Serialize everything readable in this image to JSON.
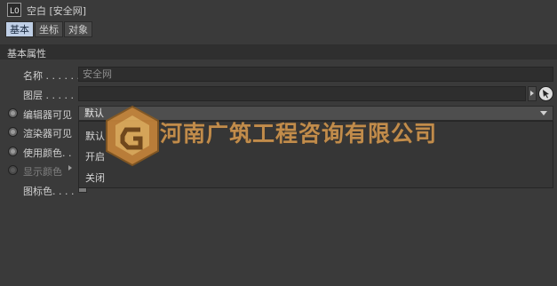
{
  "window": {
    "title": "空白 [安全网]",
    "object_icon_glyph": "L0"
  },
  "tabs": [
    "基本",
    "坐标",
    "对象"
  ],
  "section": {
    "title": "基本属性"
  },
  "fields": {
    "name": {
      "label": "名称 . . . . . .",
      "value": "安全网"
    },
    "layer": {
      "label": "图层 . . . . .",
      "value": ""
    },
    "editor_visible": {
      "label": "编辑器可见",
      "value": "默认"
    },
    "render_visible": {
      "label": "渲染器可见"
    },
    "use_color": {
      "label": "使用颜色. ."
    },
    "display_color": {
      "label": "显示颜色"
    },
    "icon_color": {
      "label": "图标色. . . ."
    }
  },
  "dropdown": {
    "options": [
      "默认",
      "开启",
      "关闭"
    ]
  },
  "watermark": {
    "text": "河南广筑工程咨询有限公司"
  },
  "colors": {
    "background": "#3a3a3a",
    "active_tab": "#bfcfe6",
    "watermark": "#e0a050"
  }
}
